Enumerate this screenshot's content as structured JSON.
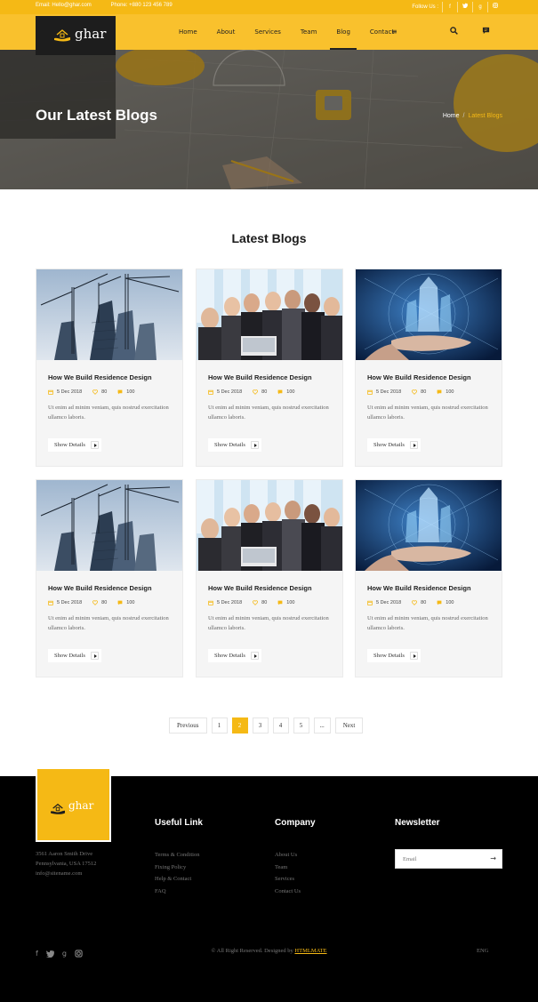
{
  "topbar": {
    "email": "Email: Hello@ghar.com",
    "phone": "Phone: +880 123 456 789",
    "follow": "Follow Us :",
    "social_icons": [
      "facebook-icon",
      "twitter-icon",
      "google-plus-icon",
      "instagram-icon"
    ]
  },
  "header": {
    "logo_text": "ghar",
    "nav": [
      "Home",
      "About",
      "Services",
      "Team",
      "Blog",
      "Contact"
    ],
    "active_nav": "Blog",
    "icons": [
      "menu-icon",
      "search-icon",
      "chat-icon"
    ]
  },
  "hero": {
    "title": "Our Latest Blogs",
    "breadcrumb": [
      "Home",
      "Latest Blogs"
    ]
  },
  "section": {
    "title": "Latest Blogs"
  },
  "posts": [
    {
      "image": "construction-cranes",
      "title": "How We Build Residence Design",
      "date": "5 Dec 2018",
      "likes": "80",
      "comments": "100",
      "text": "Ut enim ad minim veniam, quis nostrud exercitation ullamco laboris.",
      "button": "Show Details"
    },
    {
      "image": "business-team",
      "title": "How We Build Residence Design",
      "date": "5 Dec 2018",
      "likes": "80",
      "comments": "100",
      "text": "Ut enim ad minim veniam, quis nostrud exercitation ullamco laboris.",
      "button": "Show Details"
    },
    {
      "image": "holographic-building",
      "title": "How We Build Residence Design",
      "date": "5 Dec 2018",
      "likes": "80",
      "comments": "100",
      "text": "Ut enim ad minim veniam, quis nostrud exercitation ullamco laboris.",
      "button": "Show Details"
    },
    {
      "image": "construction-cranes",
      "title": "How We Build Residence Design",
      "date": "5 Dec 2018",
      "likes": "80",
      "comments": "100",
      "text": "Ut enim ad minim veniam, quis nostrud exercitation ullamco laboris.",
      "button": "Show Details"
    },
    {
      "image": "business-team",
      "title": "How We Build Residence Design",
      "date": "5 Dec 2018",
      "likes": "80",
      "comments": "100",
      "text": "Ut enim ad minim veniam, quis nostrud exercitation ullamco laboris.",
      "button": "Show Details"
    },
    {
      "image": "holographic-building",
      "title": "How We Build Residence Design",
      "date": "5 Dec 2018",
      "likes": "80",
      "comments": "100",
      "text": "Ut enim ad minim veniam, quis nostrud exercitation ullamco laboris.",
      "button": "Show Details"
    }
  ],
  "pagination": {
    "prev": "Previous",
    "pages": [
      "1",
      "2",
      "3",
      "4",
      "5",
      "..."
    ],
    "current": "2",
    "next": "Next"
  },
  "footer": {
    "logo_text": "ghar",
    "address": [
      "3561 Aaron Smith Drive",
      "Pennsylvania, USA 17512",
      "info@sitename.com"
    ],
    "useful_title": "Useful Link",
    "useful_links": [
      "Terms & Condition",
      "Fixing Policy",
      "Help & Contact",
      "FAQ"
    ],
    "company_title": "Company",
    "company_links": [
      "About Us",
      "Team",
      "Services",
      "Contact Us"
    ],
    "newsletter_title": "Newsletter",
    "newsletter_placeholder": "Email",
    "social_icons": [
      "facebook-icon",
      "twitter-icon",
      "google-plus-icon",
      "instagram-icon"
    ],
    "copyright": "© All Right Reserved. Designed by",
    "copyright_brand": "HTMLMATE",
    "lang": "ENG"
  },
  "colors": {
    "accent": "#f5b915",
    "header_bg": "#f9c12d",
    "footer_bg": "#000000",
    "card_bg": "#f5f5f5"
  }
}
